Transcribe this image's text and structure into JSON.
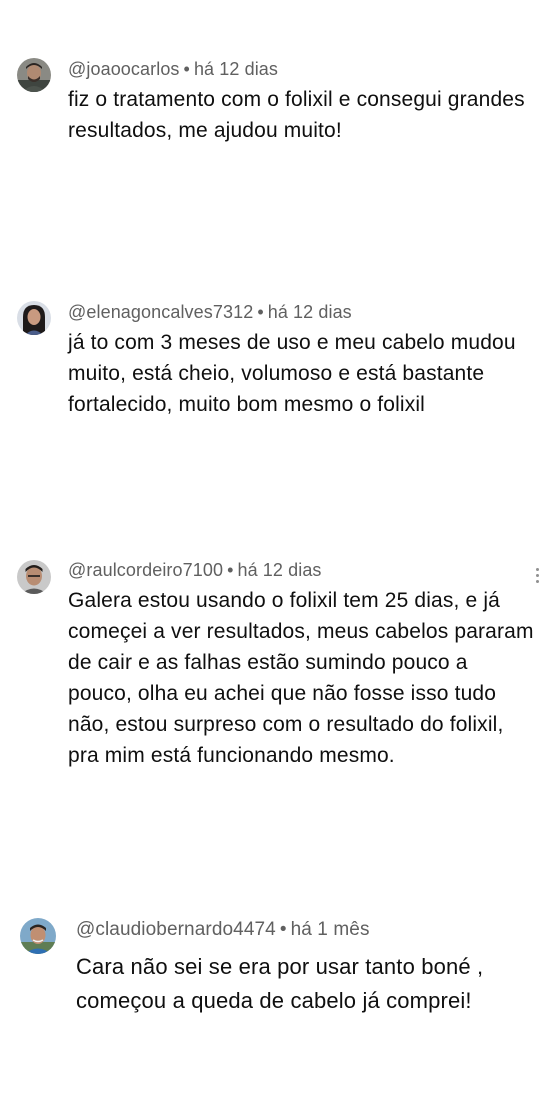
{
  "comments": [
    {
      "handle": "@joaoocarlos",
      "separator": "•",
      "time": "há 12 dias",
      "avatar_icon": "user-avatar-man-beard",
      "lines": [
        "fiz o tratamento com o folixil e consegui grandes",
        "resultados, me ajudou muito!"
      ]
    },
    {
      "handle": "@elenagoncalves7312",
      "separator": "•",
      "time": "há 12 dias",
      "avatar_icon": "user-avatar-woman",
      "lines": [
        "já to com 3 meses de uso e meu cabelo mudou",
        "muito, está cheio, volumoso e está bastante",
        "fortalecido, muito bom mesmo o folixil"
      ]
    },
    {
      "handle": "@raulcordeiro7100",
      "separator": "•",
      "time": "há 12 dias",
      "avatar_icon": "user-avatar-man",
      "lines": [
        "Galera estou usando o folixil tem 25 dias, e já",
        "começei a ver resultados, meus cabelos pararam",
        "de cair e as falhas estão sumindo pouco a",
        "pouco, olha eu achei que não fosse isso tudo",
        "não, estou surpreso com o resultado do folixil,",
        "pra mim está funcionando mesmo."
      ]
    },
    {
      "handle": "@claudiobernardo4474",
      "separator": "•",
      "time": "há 1 mês",
      "avatar_icon": "user-avatar-man-outdoor",
      "lines": [
        "Cara não sei se era por usar tanto boné ,",
        "começou a queda de cabelo já comprei!"
      ]
    }
  ]
}
